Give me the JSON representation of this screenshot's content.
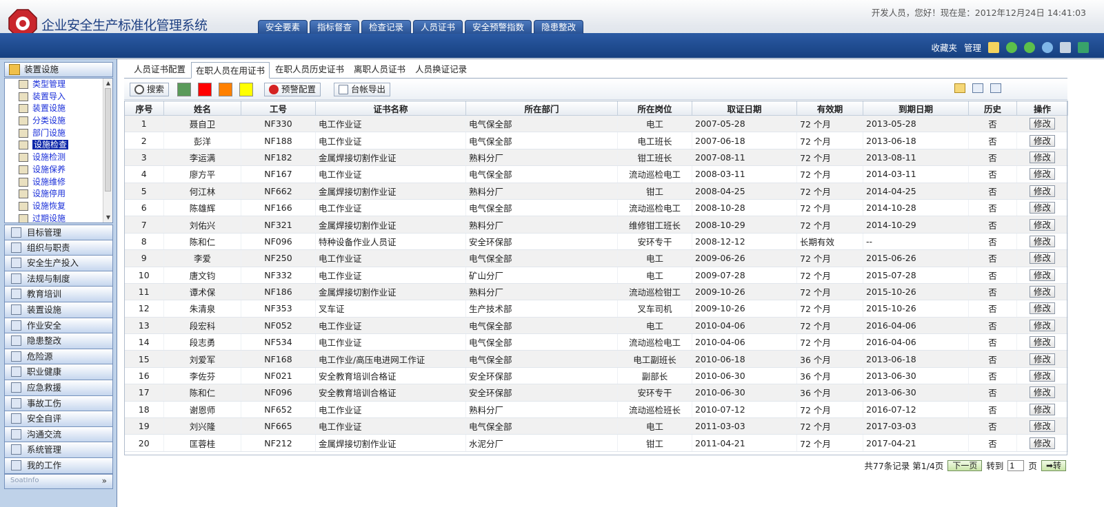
{
  "app": {
    "title": "企业安全生产标准化管理系统",
    "greeting": "开发人员，您好！现在是：2012年12月24日  14:41:03"
  },
  "nav_tabs": [
    "安全要素",
    "指标督查",
    "检查记录",
    "人员证书",
    "安全预警指数",
    "隐患整改"
  ],
  "top_links": {
    "favorites": "收藏夹",
    "manage": "管理"
  },
  "sidebar": {
    "open_group": "装置设施",
    "sub_items": [
      "类型管理",
      "装置导入",
      "装置设施",
      "分类设施",
      "部门设施",
      "设施检查",
      "设施检测",
      "设施保养",
      "设施维修",
      "设施停用",
      "设施恢复",
      "过期设施"
    ],
    "active_sub": "设施检查",
    "groups": [
      "目标管理",
      "组织与职责",
      "安全生产投入",
      "法规与制度",
      "教育培训",
      "装置设施",
      "作业安全",
      "隐患整改",
      "危险源",
      "职业健康",
      "应急救援",
      "事故工伤",
      "安全自评",
      "沟通交流",
      "系统管理",
      "我的工作"
    ],
    "footer_brand": "SoatInfo"
  },
  "tabs": [
    "人员证书配置",
    "在职人员在用证书",
    "在职人员历史证书",
    "离职人员证书",
    "人员换证记录"
  ],
  "active_tab": "在职人员在用证书",
  "toolbar": {
    "search": "搜索",
    "warning_config": "预警配置",
    "export": "台帐导出",
    "swatches": [
      "#5a9a5a",
      "#ff0000",
      "#ff8000",
      "#ffff00"
    ]
  },
  "table": {
    "headers": [
      "序号",
      "姓名",
      "工号",
      "证书名称",
      "所在部门",
      "所在岗位",
      "取证日期",
      "有效期",
      "到期日期",
      "历史",
      "操作"
    ],
    "edit_label": "修改",
    "rows": [
      [
        "1",
        "聂自卫",
        "NF330",
        "电工作业证",
        "电气保全部",
        "电工",
        "2007-05-28",
        "72 个月",
        "2013-05-28",
        "否"
      ],
      [
        "2",
        "彭洋",
        "NF188",
        "电工作业证",
        "电气保全部",
        "电工班长",
        "2007-06-18",
        "72 个月",
        "2013-06-18",
        "否"
      ],
      [
        "3",
        "李运满",
        "NF182",
        "金属焊接切割作业证",
        "熟料分厂",
        "钳工班长",
        "2007-08-11",
        "72 个月",
        "2013-08-11",
        "否"
      ],
      [
        "4",
        "廖方平",
        "NF167",
        "电工作业证",
        "电气保全部",
        "流动巡检电工",
        "2008-03-11",
        "72 个月",
        "2014-03-11",
        "否"
      ],
      [
        "5",
        "何江林",
        "NF662",
        "金属焊接切割作业证",
        "熟料分厂",
        "钳工",
        "2008-04-25",
        "72 个月",
        "2014-04-25",
        "否"
      ],
      [
        "6",
        "陈雄辉",
        "NF166",
        "电工作业证",
        "电气保全部",
        "流动巡检电工",
        "2008-10-28",
        "72 个月",
        "2014-10-28",
        "否"
      ],
      [
        "7",
        "刘佑兴",
        "NF321",
        "金属焊接切割作业证",
        "熟料分厂",
        "维修钳工班长",
        "2008-10-29",
        "72 个月",
        "2014-10-29",
        "否"
      ],
      [
        "8",
        "陈和仁",
        "NF096",
        "特种设备作业人员证",
        "安全环保部",
        "安环专干",
        "2008-12-12",
        "长期有效",
        "--",
        "否"
      ],
      [
        "9",
        "李爱",
        "NF250",
        "电工作业证",
        "电气保全部",
        "电工",
        "2009-06-26",
        "72 个月",
        "2015-06-26",
        "否"
      ],
      [
        "10",
        "唐文钧",
        "NF332",
        "电工作业证",
        "矿山分厂",
        "电工",
        "2009-07-28",
        "72 个月",
        "2015-07-28",
        "否"
      ],
      [
        "11",
        "谭术保",
        "NF186",
        "金属焊接切割作业证",
        "熟料分厂",
        "流动巡检钳工",
        "2009-10-26",
        "72 个月",
        "2015-10-26",
        "否"
      ],
      [
        "12",
        "朱清泉",
        "NF353",
        "叉车证",
        "生产技术部",
        "叉车司机",
        "2009-10-26",
        "72 个月",
        "2015-10-26",
        "否"
      ],
      [
        "13",
        "段宏科",
        "NF052",
        "电工作业证",
        "电气保全部",
        "电工",
        "2010-04-06",
        "72 个月",
        "2016-04-06",
        "否"
      ],
      [
        "14",
        "段志勇",
        "NF534",
        "电工作业证",
        "电气保全部",
        "流动巡检电工",
        "2010-04-06",
        "72 个月",
        "2016-04-06",
        "否"
      ],
      [
        "15",
        "刘爱军",
        "NF168",
        "电工作业/高压电进网工作证",
        "电气保全部",
        "电工副班长",
        "2010-06-18",
        "36 个月",
        "2013-06-18",
        "否"
      ],
      [
        "16",
        "李佐芬",
        "NF021",
        "安全教育培训合格证",
        "安全环保部",
        "副部长",
        "2010-06-30",
        "36 个月",
        "2013-06-30",
        "否"
      ],
      [
        "17",
        "陈和仁",
        "NF096",
        "安全教育培训合格证",
        "安全环保部",
        "安环专干",
        "2010-06-30",
        "36 个月",
        "2013-06-30",
        "否"
      ],
      [
        "18",
        "谢恩师",
        "NF652",
        "电工作业证",
        "熟料分厂",
        "流动巡检班长",
        "2010-07-12",
        "72 个月",
        "2016-07-12",
        "否"
      ],
      [
        "19",
        "刘兴隆",
        "NF665",
        "电工作业证",
        "电气保全部",
        "电工",
        "2011-03-03",
        "72 个月",
        "2017-03-03",
        "否"
      ],
      [
        "20",
        "匡蓉桂",
        "NF212",
        "金属焊接切割作业证",
        "水泥分厂",
        "钳工",
        "2011-04-21",
        "72 个月",
        "2017-04-21",
        "否"
      ]
    ]
  },
  "pager": {
    "summary": "共77条记录 第1/4页",
    "next": "下一页",
    "goto_prefix": "转到",
    "goto_value": "1",
    "goto_suffix": "页",
    "go": "➡转"
  }
}
